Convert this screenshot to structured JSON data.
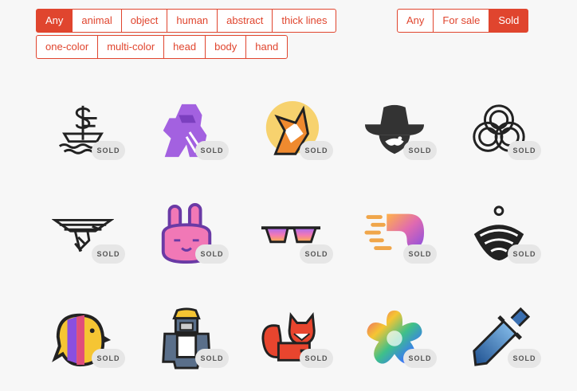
{
  "filters": {
    "row1": [
      "Any",
      "animal",
      "object",
      "human",
      "abstract",
      "thick lines"
    ],
    "row2": [
      "one-color",
      "multi-color",
      "head",
      "body",
      "hand"
    ],
    "active": "Any"
  },
  "status": {
    "options": [
      "Any",
      "For sale",
      "Sold"
    ],
    "active": "Sold"
  },
  "badge_text": "SOLD",
  "logos": [
    {
      "name": "ship-dollar-logo-icon"
    },
    {
      "name": "purple-gorilla-logo-icon"
    },
    {
      "name": "fox-circle-logo-icon"
    },
    {
      "name": "cowboy-mustache-logo-icon"
    },
    {
      "name": "knot-logo-icon"
    },
    {
      "name": "eagle-logo-icon"
    },
    {
      "name": "pink-bunny-logo-icon"
    },
    {
      "name": "sunglasses-logo-icon"
    },
    {
      "name": "fast-gradient-logo-icon"
    },
    {
      "name": "spinning-top-logo-icon"
    },
    {
      "name": "bird-logo-icon"
    },
    {
      "name": "gorilla-worker-logo-icon"
    },
    {
      "name": "fox-full-logo-icon"
    },
    {
      "name": "rainbow-flower-logo-icon"
    },
    {
      "name": "sword-logo-icon"
    }
  ],
  "colors": {
    "accent": "#e0452e",
    "background": "#f7f7f7"
  }
}
